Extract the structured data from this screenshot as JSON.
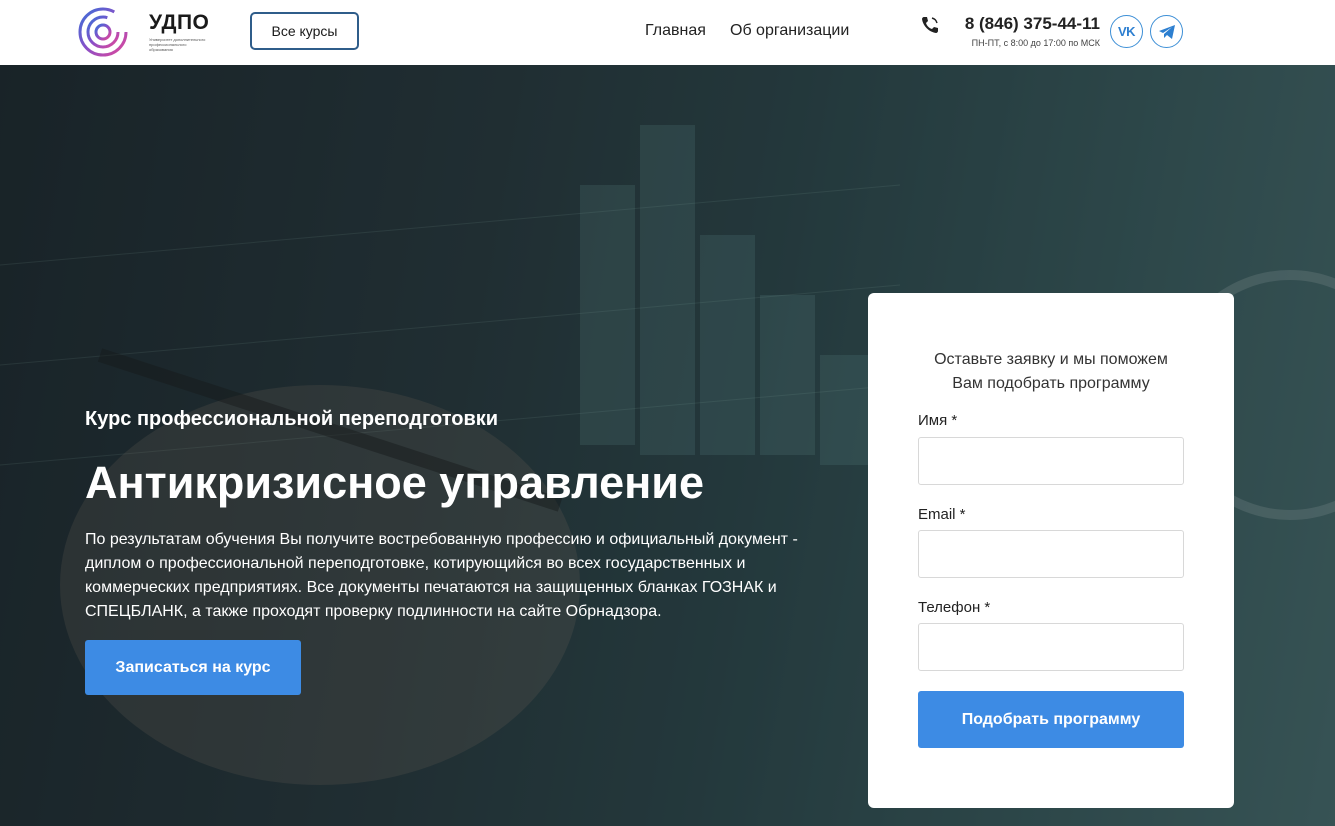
{
  "header": {
    "logo_title": "УДПО",
    "logo_subtitle": "Университет дополнительного профессионального образования",
    "all_courses": "Все курсы",
    "nav": [
      "Главная",
      "Об организации"
    ],
    "phone": "8 (846) 375-44-11",
    "hours": "ПН-ПТ, с 8:00 до 17:00 по МСК",
    "social_vk": "vk-icon",
    "social_tg": "telegram-icon"
  },
  "hero": {
    "subtitle": "Курс профессиональной переподготовки",
    "title": "Антикризисное управление",
    "description": "По результатам обучения Вы получите востребованную профессию и официальный документ - диплом о профессиональной переподготовке, котирующийся во всех государственных и коммерческих предприятиях. Все документы печатаются на защищенных бланках ГОЗНАК и СПЕЦБЛАНК, а также проходят проверку подлинности на сайте Обрнадзора.",
    "enroll_button": "Записаться на курс"
  },
  "form": {
    "lead_line1": "Оставьте заявку и мы поможем",
    "lead_line2": "Вам подобрать программу",
    "name_label": "Имя *",
    "name_value": "",
    "email_label": "Email *",
    "email_value": "",
    "phone_label": "Телефон *",
    "phone_value": "",
    "submit": "Подобрать программу"
  },
  "colors": {
    "accent": "#3d8be4",
    "button_border": "#2f5d8a",
    "hero_tint": "#2f4a4e"
  }
}
